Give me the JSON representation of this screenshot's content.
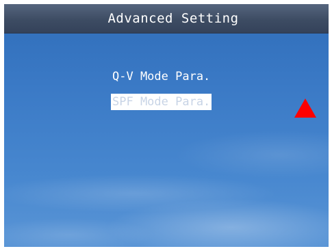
{
  "window": {
    "title": "Advanced Setting"
  },
  "menu": {
    "items": [
      {
        "label": "Q-V Mode Para.",
        "selected": false
      },
      {
        "label": "SPF Mode Para.",
        "selected": true
      }
    ]
  },
  "indicators": {
    "scroll_arrow": {
      "icon": "up-triangle-icon",
      "color": "#ff0000"
    }
  }
}
